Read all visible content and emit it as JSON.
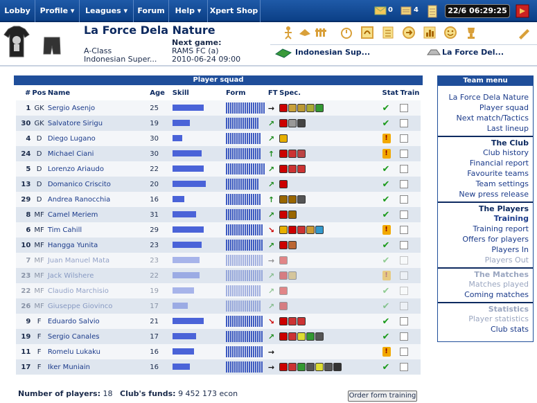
{
  "nav": {
    "items": [
      "Lobby",
      "Profile ▾",
      "Leagues ▾",
      "Forum",
      "Help ▾",
      "Xpert Shop"
    ],
    "mail_count": "0",
    "notes_count": "4",
    "clock": "22/6 06:29:25"
  },
  "header": {
    "club_name": "La Force Dela Nature",
    "class": "A-Class",
    "league": "Indonesian Super...",
    "next_game_label": "Next game:",
    "next_opponent": "RAMS FC (a)",
    "next_date": "2010-06-24 09:00",
    "league_select": "Indonesian Sup...",
    "club_select": "La Force Del..."
  },
  "squad": {
    "title": "Player squad",
    "headers": [
      "#",
      "Pos",
      "Name",
      "Age",
      "Skill",
      "Form",
      "FT",
      "Spec.",
      "Stat",
      "Train"
    ],
    "players": [
      {
        "num": "1",
        "pos": "GK",
        "name": "Sergio Asenjo",
        "age": "25",
        "skill": 0.8,
        "form": 1.0,
        "ft": "→",
        "ftc": "#111",
        "specs": [
          "#c00",
          "#c9a13a",
          "#b93",
          "#aa3",
          "#393"
        ],
        "stat": "ok",
        "faded": false
      },
      {
        "num": "30",
        "pos": "GK",
        "name": "Salvatore Sirigu",
        "age": "19",
        "skill": 0.45,
        "form": 0.85,
        "ft": "↗",
        "ftc": "#1a8a1a",
        "specs": [
          "#c00",
          "#999",
          "#444"
        ],
        "stat": "ok",
        "faded": false
      },
      {
        "num": "4",
        "pos": "D",
        "name": "Diego Lugano",
        "age": "30",
        "skill": 0.25,
        "form": 0.9,
        "ft": "↗",
        "ftc": "#1a8a1a",
        "specs": [
          "#e8b000"
        ],
        "stat": "warn",
        "faded": false
      },
      {
        "num": "24",
        "pos": "D",
        "name": "Michael Ciani",
        "age": "30",
        "skill": 0.75,
        "form": 0.9,
        "ft": "↑",
        "ftc": "#1a8a1a",
        "specs": [
          "#c00",
          "#c33",
          "#b44"
        ],
        "stat": "warn",
        "faded": false
      },
      {
        "num": "5",
        "pos": "D",
        "name": "Lorenzo Ariaudo",
        "age": "22",
        "skill": 0.8,
        "form": 1.0,
        "ft": "↗",
        "ftc": "#1a8a1a",
        "specs": [
          "#c00",
          "#c33",
          "#c33"
        ],
        "stat": "ok",
        "faded": false
      },
      {
        "num": "13",
        "pos": "D",
        "name": "Domanico Criscito",
        "age": "20",
        "skill": 0.85,
        "form": 0.85,
        "ft": "↗",
        "ftc": "#1a8a1a",
        "specs": [
          "#c00"
        ],
        "stat": "ok",
        "faded": false
      },
      {
        "num": "29",
        "pos": "D",
        "name": "Andrea Ranocchia",
        "age": "16",
        "skill": 0.3,
        "form": 0.9,
        "ft": "↑",
        "ftc": "#1a8a1a",
        "specs": [
          "#960",
          "#960",
          "#555"
        ],
        "stat": "ok",
        "faded": false
      },
      {
        "num": "8",
        "pos": "MF",
        "name": "Camel Meriem",
        "age": "31",
        "skill": 0.6,
        "form": 0.9,
        "ft": "↗",
        "ftc": "#1a8a1a",
        "specs": [
          "#c00",
          "#960"
        ],
        "stat": "ok",
        "faded": false
      },
      {
        "num": "6",
        "pos": "MF",
        "name": "Tim Cahill",
        "age": "29",
        "skill": 0.8,
        "form": 0.95,
        "ft": "↘",
        "ftc": "#c00",
        "specs": [
          "#e8b000",
          "#c00",
          "#c33",
          "#c93",
          "#39c"
        ],
        "stat": "warn",
        "faded": false
      },
      {
        "num": "10",
        "pos": "MF",
        "name": "Hangga Yunita",
        "age": "23",
        "skill": 0.75,
        "form": 0.95,
        "ft": "↗",
        "ftc": "#1a8a1a",
        "specs": [
          "#c00",
          "#b63"
        ],
        "stat": "ok",
        "faded": false
      },
      {
        "num": "7",
        "pos": "MF",
        "name": "Juan Manuel Mata",
        "age": "23",
        "skill": 0.7,
        "form": 0.95,
        "ft": "→",
        "ftc": "#111",
        "specs": [
          "#c00"
        ],
        "stat": "ok",
        "faded": true
      },
      {
        "num": "23",
        "pos": "MF",
        "name": "Jack Wilshere",
        "age": "22",
        "skill": 0.7,
        "form": 0.95,
        "ft": "↗",
        "ftc": "#1a8a1a",
        "specs": [
          "#c00",
          "#c9a13a"
        ],
        "stat": "warn",
        "faded": true
      },
      {
        "num": "22",
        "pos": "MF",
        "name": "Claudio Marchisio",
        "age": "19",
        "skill": 0.55,
        "form": 0.9,
        "ft": "↗",
        "ftc": "#1a8a1a",
        "specs": [
          "#c00"
        ],
        "stat": "ok",
        "faded": true
      },
      {
        "num": "26",
        "pos": "MF",
        "name": "Giuseppe Giovinco",
        "age": "17",
        "skill": 0.4,
        "form": 0.9,
        "ft": "↗",
        "ftc": "#1a8a1a",
        "specs": [
          "#c00"
        ],
        "stat": "ok",
        "faded": true
      },
      {
        "num": "9",
        "pos": "F",
        "name": "Eduardo Salvio",
        "age": "21",
        "skill": 0.8,
        "form": 0.95,
        "ft": "↘",
        "ftc": "#c00",
        "specs": [
          "#c00",
          "#c33",
          "#c33"
        ],
        "stat": "ok",
        "faded": false
      },
      {
        "num": "19",
        "pos": "F",
        "name": "Sergio Canales",
        "age": "17",
        "skill": 0.6,
        "form": 0.95,
        "ft": "↗",
        "ftc": "#1a8a1a",
        "specs": [
          "#c00",
          "#c33",
          "#dd3",
          "#393",
          "#555"
        ],
        "stat": "ok",
        "faded": false
      },
      {
        "num": "11",
        "pos": "F",
        "name": "Romelu Lukaku",
        "age": "16",
        "skill": 0.55,
        "form": 0.95,
        "ft": "→",
        "ftc": "#111",
        "specs": [],
        "stat": "warn",
        "faded": false
      },
      {
        "num": "17",
        "pos": "F",
        "name": "Iker Muniain",
        "age": "16",
        "skill": 0.45,
        "form": 0.95,
        "ft": "→",
        "ftc": "#111",
        "specs": [
          "#c00",
          "#c33",
          "#393",
          "#555",
          "#dd3",
          "#555",
          "#333"
        ],
        "stat": "ok",
        "faded": false
      }
    ],
    "players_label": "Number of players:",
    "players_count": "18",
    "funds_label": "Club's funds:",
    "funds_value": "9 452 173 econ",
    "order_button": "Order form training"
  },
  "teammenu": {
    "title": "Team menu",
    "groups": [
      {
        "head": null,
        "items": [
          {
            "t": "La Force Dela Nature",
            "d": false,
            "b": false
          },
          {
            "t": "Player squad",
            "d": false,
            "b": false
          },
          {
            "t": "Next match/Tactics",
            "d": false,
            "b": false
          },
          {
            "t": "Last lineup",
            "d": false,
            "b": false
          }
        ]
      },
      {
        "head": "The Club",
        "items": [
          {
            "t": "Club history",
            "d": false,
            "b": false
          },
          {
            "t": "Financial report",
            "d": false,
            "b": false
          },
          {
            "t": "Favourite teams",
            "d": false,
            "b": false
          },
          {
            "t": "Team settings",
            "d": false,
            "b": false
          },
          {
            "t": "New press release",
            "d": false,
            "b": false
          }
        ]
      },
      {
        "head": "The Players",
        "items": [
          {
            "t": "Training",
            "d": false,
            "b": true
          },
          {
            "t": "Training report",
            "d": false,
            "b": false
          },
          {
            "t": "Offers for players",
            "d": false,
            "b": false
          },
          {
            "t": "Players In",
            "d": false,
            "b": false
          },
          {
            "t": "Players Out",
            "d": true,
            "b": false
          }
        ]
      },
      {
        "head": "The Matches",
        "hd": true,
        "items": [
          {
            "t": "Matches played",
            "d": true,
            "b": false
          },
          {
            "t": "Coming matches",
            "d": false,
            "b": false
          }
        ]
      },
      {
        "head": "Statistics",
        "hd": true,
        "items": [
          {
            "t": "Player statistics",
            "d": true,
            "b": false
          },
          {
            "t": "Club stats",
            "d": false,
            "b": false
          }
        ]
      }
    ]
  }
}
